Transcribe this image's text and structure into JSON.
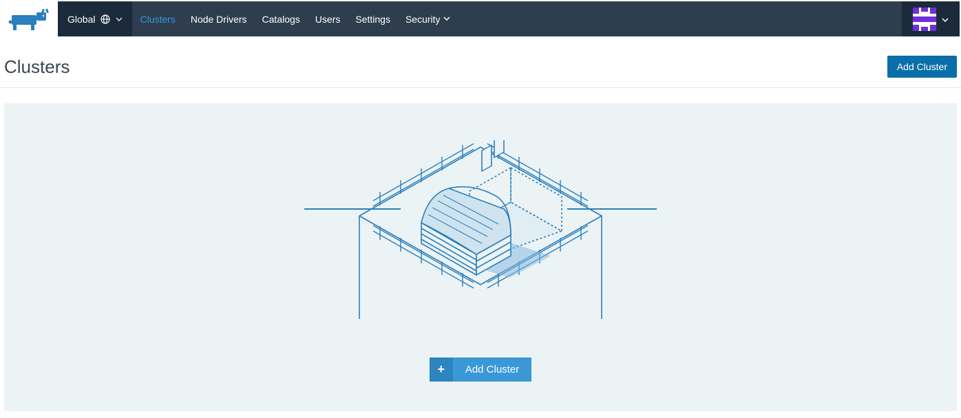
{
  "topbar": {
    "scope_label": "Global",
    "nav": [
      {
        "label": "Clusters",
        "active": true,
        "has_chevron": false
      },
      {
        "label": "Node Drivers",
        "active": false,
        "has_chevron": false
      },
      {
        "label": "Catalogs",
        "active": false,
        "has_chevron": false
      },
      {
        "label": "Users",
        "active": false,
        "has_chevron": false
      },
      {
        "label": "Settings",
        "active": false,
        "has_chevron": false
      },
      {
        "label": "Security",
        "active": false,
        "has_chevron": true
      }
    ]
  },
  "page": {
    "title": "Clusters",
    "add_button": "Add Cluster"
  },
  "empty": {
    "add_button": "Add Cluster"
  },
  "colors": {
    "topbar_bg": "#2e3e4e",
    "topbar_dark": "#1b2b3b",
    "accent": "#3497da",
    "primary_btn": "#0a6ea8",
    "empty_bg": "#ecf3f4",
    "avatar_accent": "#6e2fd9"
  }
}
